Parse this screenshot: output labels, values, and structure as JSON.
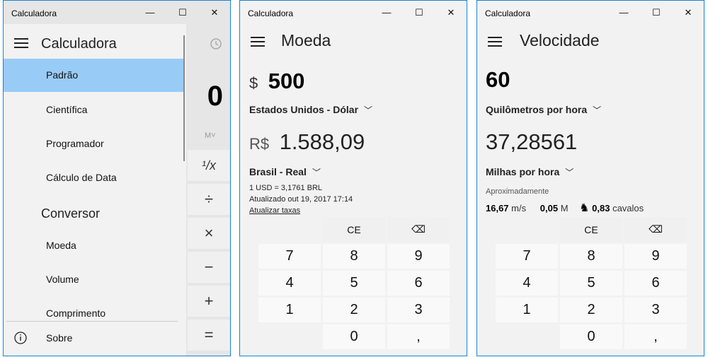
{
  "windows": [
    {
      "title": "Calculadora",
      "controls": {
        "minimize": "—",
        "maximize": "☐",
        "close": "✕"
      },
      "menu_title": "Calculadora",
      "nav_items": [
        "Padrão",
        "Científica",
        "Programador",
        "Cálculo de Data"
      ],
      "section_heading": "Conversor",
      "converter_items": [
        "Moeda",
        "Volume",
        "Comprimento"
      ],
      "about_label": "Sobre",
      "display_value": "0",
      "memory_label": "M˅",
      "ops": [
        "¹/x",
        "÷",
        "×",
        "−",
        "+",
        "="
      ]
    },
    {
      "title": "Calculadora",
      "mode": "Moeda",
      "input_symbol": "$",
      "input_value": "500",
      "input_unit": "Estados Unidos - Dólar",
      "output_symbol": "R$",
      "output_value": "1.588,09",
      "output_unit": "Brasil - Real",
      "rate_line": "1 USD = 3,1761 BRL",
      "updated_line": "Atualizado out 19, 2017 17:14",
      "update_link": "Atualizar taxas",
      "keys": {
        "ce": "CE",
        "back": "⌫",
        "k7": "7",
        "k8": "8",
        "k9": "9",
        "k4": "4",
        "k5": "5",
        "k6": "6",
        "k1": "1",
        "k2": "2",
        "k3": "3",
        "k0": "0",
        "comma": ","
      }
    },
    {
      "title": "Calculadora",
      "mode": "Velocidade",
      "input_value": "60",
      "input_unit": "Quilômetros por hora",
      "output_value": "37,28561",
      "output_unit": "Milhas por hora",
      "approx_label": "Aproximadamente",
      "approx": [
        {
          "value": "16,67",
          "unit": "m/s"
        },
        {
          "value": "0,05",
          "unit": "M"
        },
        {
          "value": "0,83",
          "unit": "cavalos"
        }
      ],
      "keys": {
        "ce": "CE",
        "back": "⌫",
        "k7": "7",
        "k8": "8",
        "k9": "9",
        "k4": "4",
        "k5": "5",
        "k6": "6",
        "k1": "1",
        "k2": "2",
        "k3": "3",
        "k0": "0",
        "comma": ","
      }
    }
  ]
}
